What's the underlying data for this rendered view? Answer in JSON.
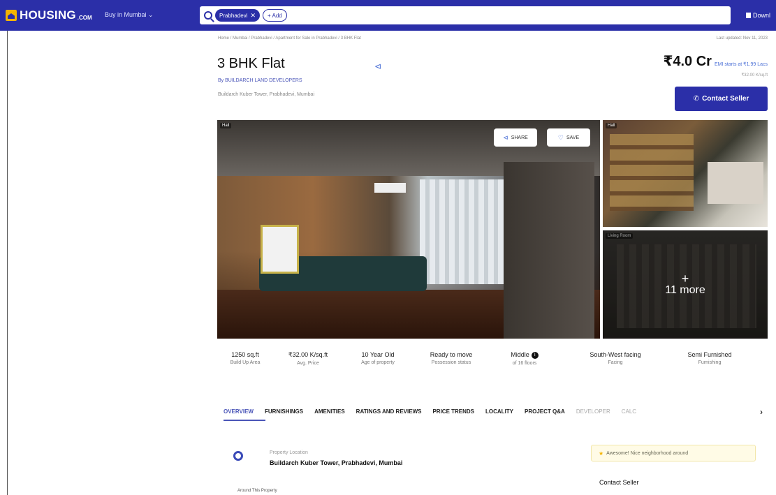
{
  "header": {
    "logo_text": "HOUSING",
    "logo_sub": ".COM",
    "city_selector": "Buy in Mumbai ⌄",
    "search_chip": "Prabhadevi",
    "add_chip": "+ Add",
    "download_label": "Downl"
  },
  "listing": {
    "breadcrumb": "Home / Mumbai / Prabhadevi / Apartment for Sale in Prabhadevi / 3 BHK Flat",
    "updated": "Last updated: Nov 11, 2023",
    "title": "3 BHK Flat",
    "builder": "By BUILDARCH LAND DEVELOPERS",
    "address": "Buildarch Kuber Tower, Prabhadevi, Mumbai",
    "price": "₹4.0 Cr",
    "emi": "EMI starts at ₹1.99 Lacs",
    "price_per_sqft": "₹32.00 K/sq.ft",
    "contact_label": "Contact Seller"
  },
  "gallery": {
    "main_tag": "Hall",
    "share_label": "SHARE",
    "save_label": "SAVE",
    "side1_tag": "Hall",
    "side2_tag": "Living Room",
    "more_label": "11 more"
  },
  "stats": [
    {
      "value": "1250 sq.ft",
      "label": "Build Up Area"
    },
    {
      "value": "₹32.00 K/sq.ft",
      "label": "Avg. Price"
    },
    {
      "value": "10 Year Old",
      "label": "Age of property"
    },
    {
      "value": "Ready to move",
      "label": "Possession status"
    },
    {
      "value": "Middle",
      "label": "of 16 floors"
    },
    {
      "value": "South-West facing",
      "label": "Facing"
    },
    {
      "value": "Semi Furnished",
      "label": "Furnishing"
    }
  ],
  "tabs": [
    "OVERVIEW",
    "FURNISHINGS",
    "AMENITIES",
    "RATINGS AND REVIEWS",
    "PRICE TRENDS",
    "LOCALITY",
    "PROJECT Q&A",
    "DEVELOPER",
    "CALC"
  ],
  "location": {
    "label": "Property Location",
    "value": "Buildarch Kuber Tower, Prabhadevi, Mumbai"
  },
  "neighborhood": "Awesome! Nice neighborhood around",
  "footer_left": "Around This Property",
  "contact_footer": "Contact Seller",
  "colors": {
    "brand": "#2b2fa8",
    "accent": "#4a55b8"
  }
}
